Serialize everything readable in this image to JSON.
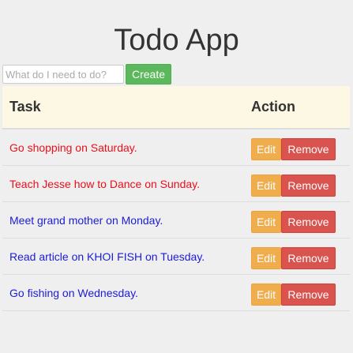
{
  "app": {
    "title": "Todo App"
  },
  "create": {
    "placeholder": "What do I need to do?",
    "value": "",
    "button_label": "Create"
  },
  "table": {
    "headers": {
      "task": "Task",
      "action": "Action"
    },
    "rows": [
      {
        "text": "Go shopping on Saturday.",
        "color": "#e8101c"
      },
      {
        "text": "Teach Jesse how to Dance on Sunday.",
        "color": "#e8101c"
      },
      {
        "text": "Meet grand mother on Monday.",
        "color": "#1c1cd6"
      },
      {
        "text": "Read article on KHOI FISH on Tuesday.",
        "color": "#1c1cd6"
      },
      {
        "text": "Go fishing on Wednesday.",
        "color": "#1c1cd6"
      }
    ],
    "edit_label": "Edit",
    "remove_label": "Remove"
  },
  "colors": {
    "create_button": "#5cb85c",
    "edit_button": "#f0ad4e",
    "remove_button": "#d9534f",
    "header_background": "#fcf8e3",
    "page_background": "#efefef"
  }
}
